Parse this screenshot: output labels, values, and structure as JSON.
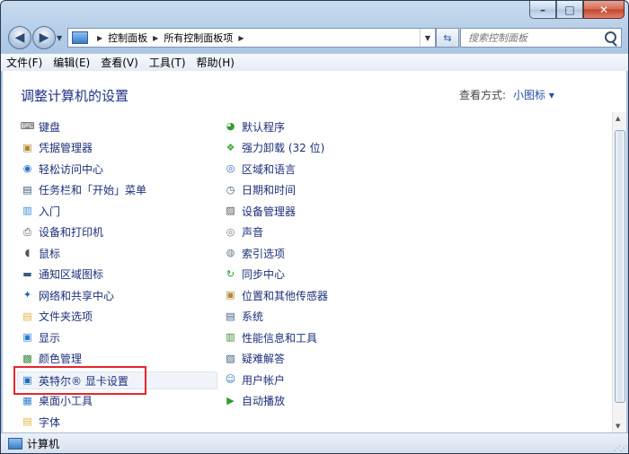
{
  "window": {
    "min_label": "–",
    "max_label": "□",
    "close_label": "✕"
  },
  "nav": {
    "back_glyph": "◀",
    "forward_glyph": "▶",
    "breadcrumb": [
      "控制面板",
      "所有控制面板项"
    ],
    "search_placeholder": "搜索控制面板"
  },
  "menu": [
    "文件(F)",
    "编辑(E)",
    "查看(V)",
    "工具(T)",
    "帮助(H)"
  ],
  "content": {
    "title": "调整计算机的设置",
    "view_by_label": "查看方式:",
    "view_by_value": "小图标 ▾"
  },
  "left_items": [
    {
      "label": "键盘",
      "icon": "keyboard-icon",
      "glyph": "⌨",
      "color": "#555555"
    },
    {
      "label": "凭据管理器",
      "icon": "credential-icon",
      "glyph": "▣",
      "color": "#b08a2e"
    },
    {
      "label": "轻松访问中心",
      "icon": "ease-of-access-icon",
      "glyph": "◉",
      "color": "#2b6cc4"
    },
    {
      "label": "任务栏和「开始」菜单",
      "icon": "taskbar-icon",
      "glyph": "▤",
      "color": "#3b5a80"
    },
    {
      "label": "入门",
      "icon": "getting-started-icon",
      "glyph": "▥",
      "color": "#2e8bd6"
    },
    {
      "label": "设备和打印机",
      "icon": "printer-icon",
      "glyph": "⎙",
      "color": "#4a4a4a"
    },
    {
      "label": "鼠标",
      "icon": "mouse-icon",
      "glyph": "◖",
      "color": "#555555"
    },
    {
      "label": "通知区域图标",
      "icon": "notification-icon",
      "glyph": "▬",
      "color": "#3b5a80"
    },
    {
      "label": "网络和共享中心",
      "icon": "network-icon",
      "glyph": "✦",
      "color": "#1d5fb0"
    },
    {
      "label": "文件夹选项",
      "icon": "folder-icon",
      "glyph": "▤",
      "color": "#e0b43c"
    },
    {
      "label": "显示",
      "icon": "display-icon",
      "glyph": "▣",
      "color": "#2e7bd0"
    },
    {
      "label": "颜色管理",
      "icon": "color-management-icon",
      "glyph": "▩",
      "color": "#3c8a3c"
    },
    {
      "label": "英特尔® 显卡设置",
      "icon": "intel-graphics-icon",
      "glyph": "▣",
      "color": "#1e6fc0"
    },
    {
      "label": "桌面小工具",
      "icon": "gadgets-icon",
      "glyph": "▦",
      "color": "#2e7bd0"
    },
    {
      "label": "字体",
      "icon": "fonts-icon",
      "glyph": "▤",
      "color": "#e0b43c"
    }
  ],
  "right_items": [
    {
      "label": "默认程序",
      "icon": "default-programs-icon",
      "glyph": "◕",
      "color": "#2f9a2f"
    },
    {
      "label": "强力卸载 (32 位)",
      "icon": "uninstall-icon",
      "glyph": "❖",
      "color": "#3aa63a"
    },
    {
      "label": "区域和语言",
      "icon": "region-icon",
      "glyph": "◎",
      "color": "#2b6cc4"
    },
    {
      "label": "日期和时间",
      "icon": "clock-icon",
      "glyph": "◷",
      "color": "#3b5a80"
    },
    {
      "label": "设备管理器",
      "icon": "device-manager-icon",
      "glyph": "▨",
      "color": "#555555"
    },
    {
      "label": "声音",
      "icon": "sound-icon",
      "glyph": "◎",
      "color": "#777777"
    },
    {
      "label": "索引选项",
      "icon": "indexing-icon",
      "glyph": "◍",
      "color": "#6a7a8a"
    },
    {
      "label": "同步中心",
      "icon": "sync-icon",
      "glyph": "↻",
      "color": "#2f9a2f"
    },
    {
      "label": "位置和其他传感器",
      "icon": "sensor-icon",
      "glyph": "▣",
      "color": "#b08a2e"
    },
    {
      "label": "系统",
      "icon": "system-icon",
      "glyph": "▤",
      "color": "#3b5a80"
    },
    {
      "label": "性能信息和工具",
      "icon": "performance-icon",
      "glyph": "▥",
      "color": "#3a8a3a"
    },
    {
      "label": "疑难解答",
      "icon": "troubleshooting-icon",
      "glyph": "▧",
      "color": "#3b5a80"
    },
    {
      "label": "用户帐户",
      "icon": "user-accounts-icon",
      "glyph": "☺",
      "color": "#2b6cc4"
    },
    {
      "label": "自动播放",
      "icon": "autoplay-icon",
      "glyph": "▶",
      "color": "#2f9a2f"
    }
  ],
  "status": {
    "label": "计算机"
  }
}
